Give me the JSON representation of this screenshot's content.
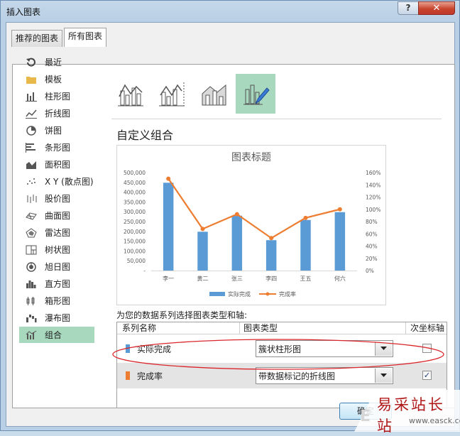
{
  "window": {
    "title": "插入图表",
    "help_label": "?",
    "close_label": "✕"
  },
  "tabs": [
    {
      "label": "推荐的图表",
      "active": false
    },
    {
      "label": "所有图表",
      "active": true
    }
  ],
  "sidebar": {
    "selected": "组合",
    "items": [
      {
        "label": "最近",
        "icon": "recent-icon"
      },
      {
        "label": "模板",
        "icon": "folder-icon"
      },
      {
        "label": "柱形图",
        "icon": "column-chart-icon"
      },
      {
        "label": "折线图",
        "icon": "line-chart-icon"
      },
      {
        "label": "饼图",
        "icon": "pie-chart-icon"
      },
      {
        "label": "条形图",
        "icon": "bar-chart-icon"
      },
      {
        "label": "面积图",
        "icon": "area-chart-icon"
      },
      {
        "label": "X Y (散点图)",
        "icon": "scatter-chart-icon"
      },
      {
        "label": "股价图",
        "icon": "stock-chart-icon"
      },
      {
        "label": "曲面图",
        "icon": "surface-chart-icon"
      },
      {
        "label": "雷达图",
        "icon": "radar-chart-icon"
      },
      {
        "label": "树状图",
        "icon": "treemap-chart-icon"
      },
      {
        "label": "旭日图",
        "icon": "sunburst-chart-icon"
      },
      {
        "label": "直方图",
        "icon": "histogram-chart-icon"
      },
      {
        "label": "箱形图",
        "icon": "box-whisker-chart-icon"
      },
      {
        "label": "瀑布图",
        "icon": "waterfall-chart-icon"
      },
      {
        "label": "组合",
        "icon": "combo-chart-icon"
      }
    ]
  },
  "combo_section": {
    "heading": "自定义组合"
  },
  "chart_data": {
    "type": "bar",
    "title": "图表标题",
    "categories": [
      "李一",
      "黄二",
      "张三",
      "李四",
      "王五",
      "何六"
    ],
    "series": [
      {
        "name": "实际完成",
        "type": "bar",
        "axis": "primary",
        "color": "#5b9bd5",
        "values": [
          448000,
          198000,
          280000,
          155000,
          258000,
          298000
        ]
      },
      {
        "name": "完成率",
        "type": "line",
        "axis": "secondary",
        "color": "#ed7d31",
        "values": [
          1.5,
          0.68,
          0.92,
          0.53,
          0.86,
          1.0
        ]
      }
    ],
    "primary_axis": {
      "min": 0,
      "max": 500000,
      "step": 50000,
      "ticks": [
        "-",
        "50,000",
        "100,000",
        "150,000",
        "200,000",
        "250,000",
        "300,000",
        "350,000",
        "400,000",
        "450,000",
        "500,000"
      ]
    },
    "secondary_axis": {
      "min": 0,
      "max": 1.6,
      "step": 0.2,
      "ticks": [
        "0%",
        "20%",
        "40%",
        "60%",
        "80%",
        "100%",
        "120%",
        "140%",
        "160%"
      ]
    },
    "legend": "bottom",
    "grid": false
  },
  "series_table": {
    "instruction": "为您的数据系列选择图表类型和轴:",
    "headers": {
      "name": "系列名称",
      "type": "图表类型",
      "secondary": "次坐标轴"
    },
    "rows": [
      {
        "name": "实际完成",
        "color": "#5b9bd5",
        "chart_type": "簇状柱形图",
        "secondary_axis": false
      },
      {
        "name": "完成率",
        "color": "#ed7d31",
        "chart_type": "带数据标记的折线图",
        "secondary_axis": true
      }
    ]
  },
  "footer": {
    "ok_label": "确定"
  },
  "watermark": {
    "text": "易采站长站",
    "url": "www.easck.com"
  }
}
